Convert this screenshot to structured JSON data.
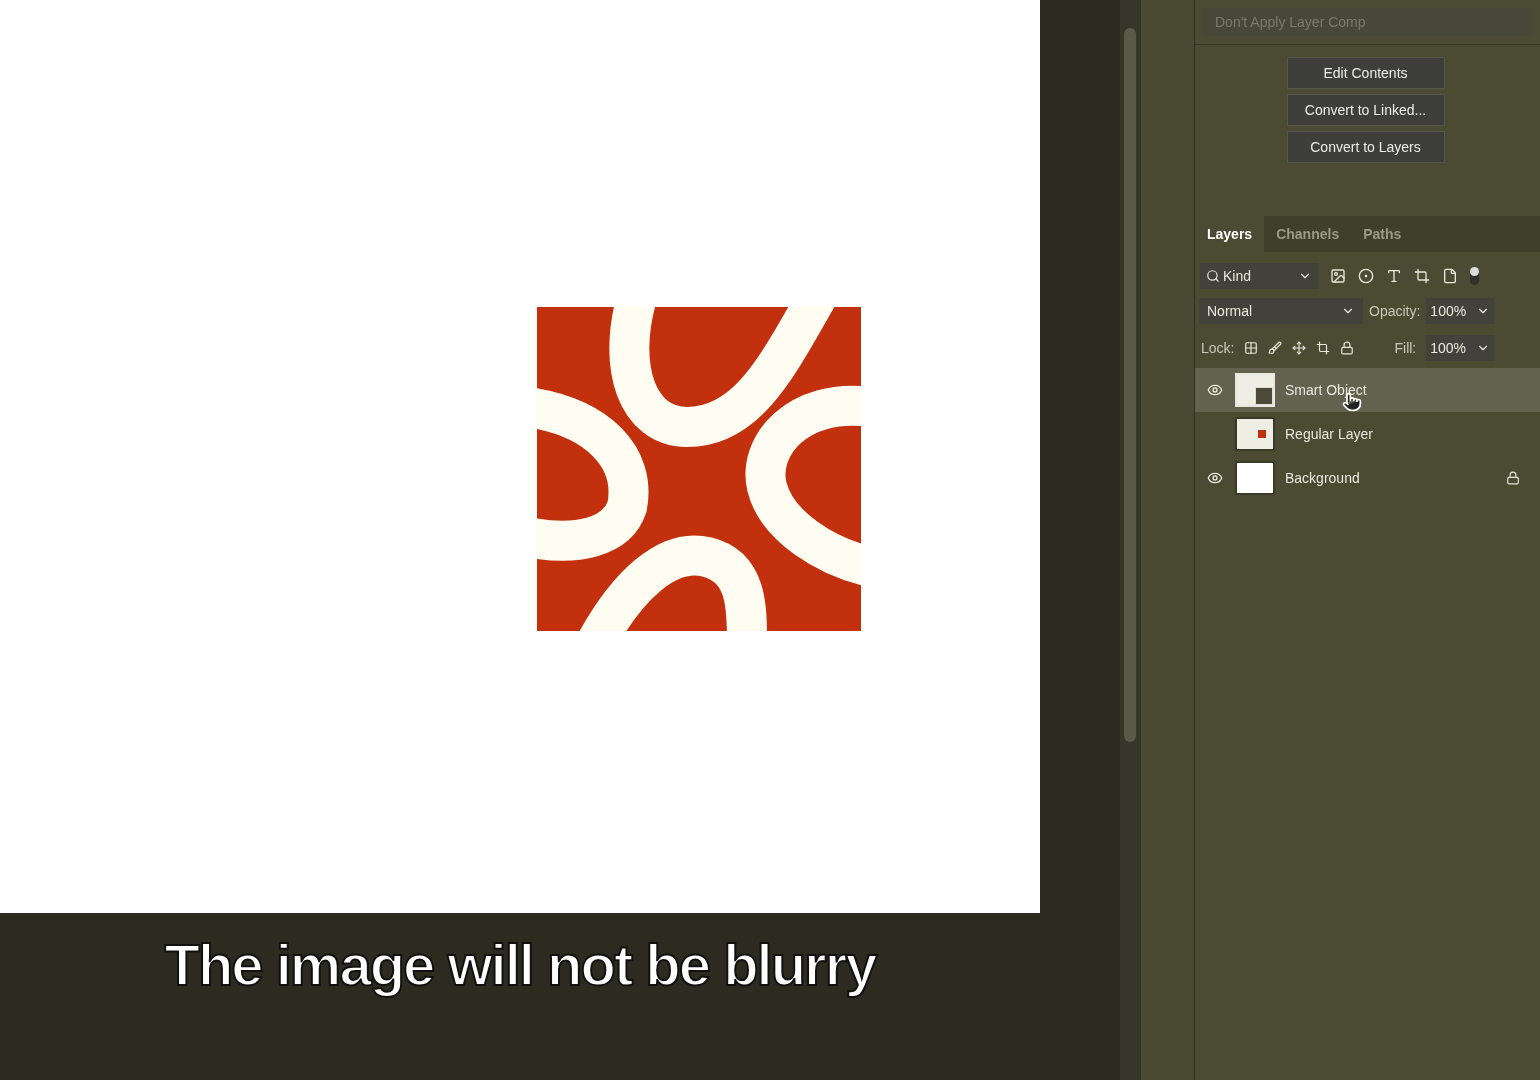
{
  "layer_comp": {
    "value": "Don't Apply Layer Comp",
    "disabled": true
  },
  "buttons": [
    "Edit Contents",
    "Convert to Linked...",
    "Convert to Layers"
  ],
  "tabs": [
    {
      "label": "Layers",
      "selected": true
    },
    {
      "label": "Channels",
      "selected": false
    },
    {
      "label": "Paths",
      "selected": false
    }
  ],
  "filter": {
    "value": "Kind"
  },
  "blend_mode": {
    "value": "Normal"
  },
  "opacity": {
    "label": "Opacity:",
    "value": "100%"
  },
  "lock": {
    "label": "Lock:"
  },
  "fill": {
    "label": "Fill:",
    "value": "100%"
  },
  "layers": [
    {
      "name": "Smart Object",
      "kind": "smart",
      "visible": true,
      "selected": true,
      "locked": false
    },
    {
      "name": "Regular Layer",
      "kind": "regular",
      "visible": false,
      "selected": false,
      "locked": false
    },
    {
      "name": "Background",
      "kind": "background",
      "visible": true,
      "selected": false,
      "locked": true
    }
  ],
  "caption": "The image will not be blurry"
}
